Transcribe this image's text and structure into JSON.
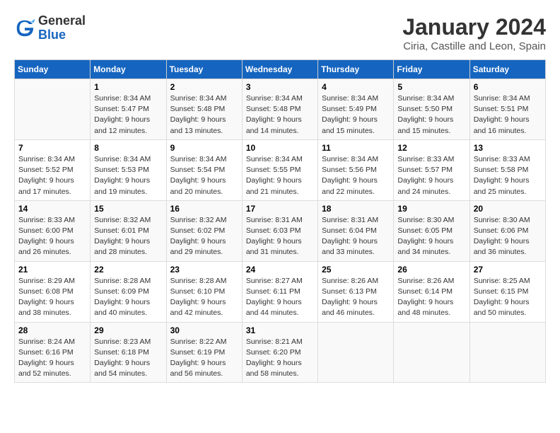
{
  "header": {
    "logo_general": "General",
    "logo_blue": "Blue",
    "month_title": "January 2024",
    "location": "Ciria, Castille and Leon, Spain"
  },
  "weekdays": [
    "Sunday",
    "Monday",
    "Tuesday",
    "Wednesday",
    "Thursday",
    "Friday",
    "Saturday"
  ],
  "weeks": [
    [
      {
        "day": "",
        "info": ""
      },
      {
        "day": "1",
        "info": "Sunrise: 8:34 AM\nSunset: 5:47 PM\nDaylight: 9 hours\nand 12 minutes."
      },
      {
        "day": "2",
        "info": "Sunrise: 8:34 AM\nSunset: 5:48 PM\nDaylight: 9 hours\nand 13 minutes."
      },
      {
        "day": "3",
        "info": "Sunrise: 8:34 AM\nSunset: 5:48 PM\nDaylight: 9 hours\nand 14 minutes."
      },
      {
        "day": "4",
        "info": "Sunrise: 8:34 AM\nSunset: 5:49 PM\nDaylight: 9 hours\nand 15 minutes."
      },
      {
        "day": "5",
        "info": "Sunrise: 8:34 AM\nSunset: 5:50 PM\nDaylight: 9 hours\nand 15 minutes."
      },
      {
        "day": "6",
        "info": "Sunrise: 8:34 AM\nSunset: 5:51 PM\nDaylight: 9 hours\nand 16 minutes."
      }
    ],
    [
      {
        "day": "7",
        "info": "Sunrise: 8:34 AM\nSunset: 5:52 PM\nDaylight: 9 hours\nand 17 minutes."
      },
      {
        "day": "8",
        "info": "Sunrise: 8:34 AM\nSunset: 5:53 PM\nDaylight: 9 hours\nand 19 minutes."
      },
      {
        "day": "9",
        "info": "Sunrise: 8:34 AM\nSunset: 5:54 PM\nDaylight: 9 hours\nand 20 minutes."
      },
      {
        "day": "10",
        "info": "Sunrise: 8:34 AM\nSunset: 5:55 PM\nDaylight: 9 hours\nand 21 minutes."
      },
      {
        "day": "11",
        "info": "Sunrise: 8:34 AM\nSunset: 5:56 PM\nDaylight: 9 hours\nand 22 minutes."
      },
      {
        "day": "12",
        "info": "Sunrise: 8:33 AM\nSunset: 5:57 PM\nDaylight: 9 hours\nand 24 minutes."
      },
      {
        "day": "13",
        "info": "Sunrise: 8:33 AM\nSunset: 5:58 PM\nDaylight: 9 hours\nand 25 minutes."
      }
    ],
    [
      {
        "day": "14",
        "info": "Sunrise: 8:33 AM\nSunset: 6:00 PM\nDaylight: 9 hours\nand 26 minutes."
      },
      {
        "day": "15",
        "info": "Sunrise: 8:32 AM\nSunset: 6:01 PM\nDaylight: 9 hours\nand 28 minutes."
      },
      {
        "day": "16",
        "info": "Sunrise: 8:32 AM\nSunset: 6:02 PM\nDaylight: 9 hours\nand 29 minutes."
      },
      {
        "day": "17",
        "info": "Sunrise: 8:31 AM\nSunset: 6:03 PM\nDaylight: 9 hours\nand 31 minutes."
      },
      {
        "day": "18",
        "info": "Sunrise: 8:31 AM\nSunset: 6:04 PM\nDaylight: 9 hours\nand 33 minutes."
      },
      {
        "day": "19",
        "info": "Sunrise: 8:30 AM\nSunset: 6:05 PM\nDaylight: 9 hours\nand 34 minutes."
      },
      {
        "day": "20",
        "info": "Sunrise: 8:30 AM\nSunset: 6:06 PM\nDaylight: 9 hours\nand 36 minutes."
      }
    ],
    [
      {
        "day": "21",
        "info": "Sunrise: 8:29 AM\nSunset: 6:08 PM\nDaylight: 9 hours\nand 38 minutes."
      },
      {
        "day": "22",
        "info": "Sunrise: 8:28 AM\nSunset: 6:09 PM\nDaylight: 9 hours\nand 40 minutes."
      },
      {
        "day": "23",
        "info": "Sunrise: 8:28 AM\nSunset: 6:10 PM\nDaylight: 9 hours\nand 42 minutes."
      },
      {
        "day": "24",
        "info": "Sunrise: 8:27 AM\nSunset: 6:11 PM\nDaylight: 9 hours\nand 44 minutes."
      },
      {
        "day": "25",
        "info": "Sunrise: 8:26 AM\nSunset: 6:13 PM\nDaylight: 9 hours\nand 46 minutes."
      },
      {
        "day": "26",
        "info": "Sunrise: 8:26 AM\nSunset: 6:14 PM\nDaylight: 9 hours\nand 48 minutes."
      },
      {
        "day": "27",
        "info": "Sunrise: 8:25 AM\nSunset: 6:15 PM\nDaylight: 9 hours\nand 50 minutes."
      }
    ],
    [
      {
        "day": "28",
        "info": "Sunrise: 8:24 AM\nSunset: 6:16 PM\nDaylight: 9 hours\nand 52 minutes."
      },
      {
        "day": "29",
        "info": "Sunrise: 8:23 AM\nSunset: 6:18 PM\nDaylight: 9 hours\nand 54 minutes."
      },
      {
        "day": "30",
        "info": "Sunrise: 8:22 AM\nSunset: 6:19 PM\nDaylight: 9 hours\nand 56 minutes."
      },
      {
        "day": "31",
        "info": "Sunrise: 8:21 AM\nSunset: 6:20 PM\nDaylight: 9 hours\nand 58 minutes."
      },
      {
        "day": "",
        "info": ""
      },
      {
        "day": "",
        "info": ""
      },
      {
        "day": "",
        "info": ""
      }
    ]
  ]
}
